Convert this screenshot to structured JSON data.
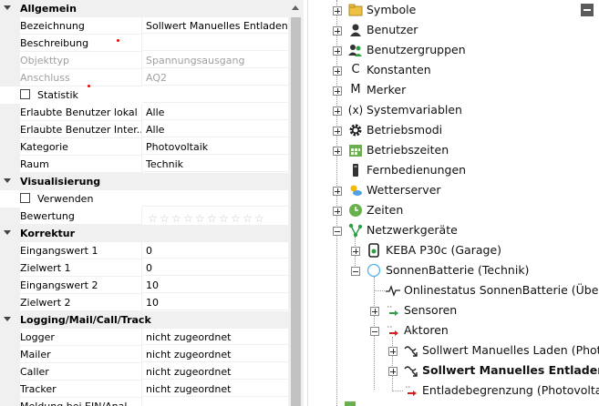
{
  "properties": {
    "allgemein": {
      "title": "Allgemein",
      "rows": [
        {
          "key": "Bezeichnung",
          "value": "Sollwert Manuelles Entladen"
        },
        {
          "key": "Beschreibung",
          "value": ""
        },
        {
          "key": "Objekttyp",
          "value": "Spannungsausgang"
        },
        {
          "key": "Anschluss",
          "value": "AQ2"
        },
        {
          "key": "Statistik",
          "value": ""
        },
        {
          "key": "Erlaubte Benutzer lokal",
          "value": "Alle"
        },
        {
          "key": "Erlaubte Benutzer Inter...",
          "value": "Alle"
        },
        {
          "key": "Kategorie",
          "value": "Photovoltaik"
        },
        {
          "key": "Raum",
          "value": "Technik"
        }
      ]
    },
    "visualisierung": {
      "title": "Visualisierung",
      "rows": [
        {
          "key": "Verwenden",
          "value": ""
        },
        {
          "key": "Bewertung",
          "value": ""
        }
      ]
    },
    "korrektur": {
      "title": "Korrektur",
      "rows": [
        {
          "key": "Eingangswert 1",
          "value": "0"
        },
        {
          "key": "Zielwert 1",
          "value": "0"
        },
        {
          "key": "Eingangswert 2",
          "value": "10"
        },
        {
          "key": "Zielwert 2",
          "value": "10"
        }
      ]
    },
    "logging": {
      "title": "Logging/Mail/Call/Track",
      "rows": [
        {
          "key": "Logger",
          "value": "nicht zugeordnet"
        },
        {
          "key": "Mailer",
          "value": "nicht zugeordnet"
        },
        {
          "key": "Caller",
          "value": "nicht zugeordnet"
        },
        {
          "key": "Tracker",
          "value": "nicht zugeordnet"
        },
        {
          "key": "Meldung bei EIN/Anal...",
          "value": ""
        }
      ]
    }
  },
  "tree": {
    "symbole": "Symbole",
    "benutzer": "Benutzer",
    "benutzergruppen": "Benutzergruppen",
    "konstanten": "Konstanten",
    "merker": "Merker",
    "systemvariablen": "Systemvariablen",
    "betriebsmodi": "Betriebsmodi",
    "betriebszeiten": "Betriebszeiten",
    "fernbedienungen": "Fernbedienungen",
    "wetterserver": "Wetterserver",
    "zeiten": "Zeiten",
    "netzwerkgeraete": "Netzwerkgeräte",
    "keba": "KEBA P30c (Garage)",
    "sonnenbatterie": "SonnenBatterie (Technik)",
    "onlinestatus": "Onlinestatus SonnenBatterie (Über",
    "sensoren": "Sensoren",
    "aktoren": "Aktoren",
    "sollwert_laden": "Sollwert Manuelles Laden (Phot",
    "sollwert_entladen": "Sollwert Manuelles Entladen",
    "entladebegrenzung": "Entladebegrenzung (Photovolta"
  },
  "icons": {
    "konstanten": "C",
    "merker": "M",
    "systemvariablen": "(x)"
  },
  "colors": {
    "category_bg": "#f0f0f0",
    "disabled_text": "#a0a0a0",
    "required_marker": "#e00000",
    "zeiten_icon": "#6ab04c",
    "betriebszeiten_icon": "#6ab04c",
    "aktor_arrow": "#d62020",
    "sensor_arrow": "#2ea043",
    "sonnenbatterie_ring": "#4fb3e8"
  }
}
